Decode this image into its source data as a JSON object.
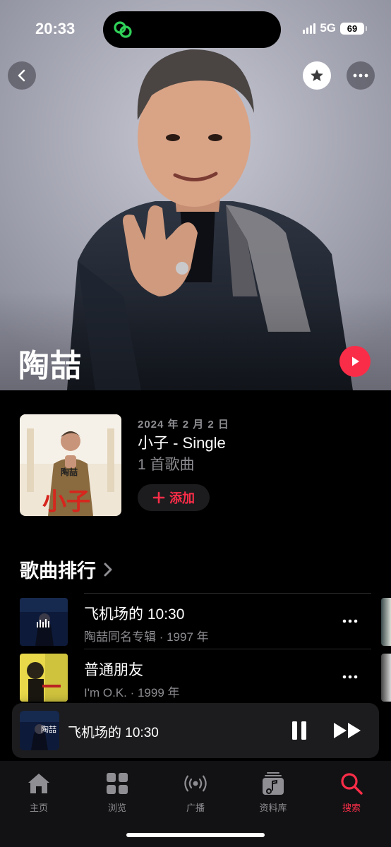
{
  "status_bar": {
    "time": "20:33",
    "network": "5G",
    "battery": "69"
  },
  "artist": {
    "name": "陶喆"
  },
  "latest_release": {
    "date": "2024 年 2 月 2 日",
    "title": "小子 - Single",
    "track_count": "1 首歌曲",
    "add_label": "添加",
    "cover_text_artist": "陶喆",
    "cover_text_title": "小子"
  },
  "top_songs": {
    "title": "歌曲排行",
    "items": [
      {
        "title": "飞机场的 10:30",
        "subtitle": "陶喆同名专辑 · 1997 年"
      },
      {
        "title": "普通朋友",
        "subtitle": "I'm O.K. · 1999 年"
      }
    ]
  },
  "now_playing": {
    "title": "飞机场的 10:30",
    "art_text": "陶喆"
  },
  "tabs": [
    {
      "label": "主页",
      "icon": "home-icon",
      "active": false
    },
    {
      "label": "浏览",
      "icon": "grid-icon",
      "active": false
    },
    {
      "label": "广播",
      "icon": "radio-icon",
      "active": false
    },
    {
      "label": "资料库",
      "icon": "library-icon",
      "active": false
    },
    {
      "label": "搜索",
      "icon": "search-icon",
      "active": true
    }
  ],
  "colors": {
    "accent": "#fa2d48",
    "secondary_text": "#8e8e93",
    "background": "#000000"
  }
}
